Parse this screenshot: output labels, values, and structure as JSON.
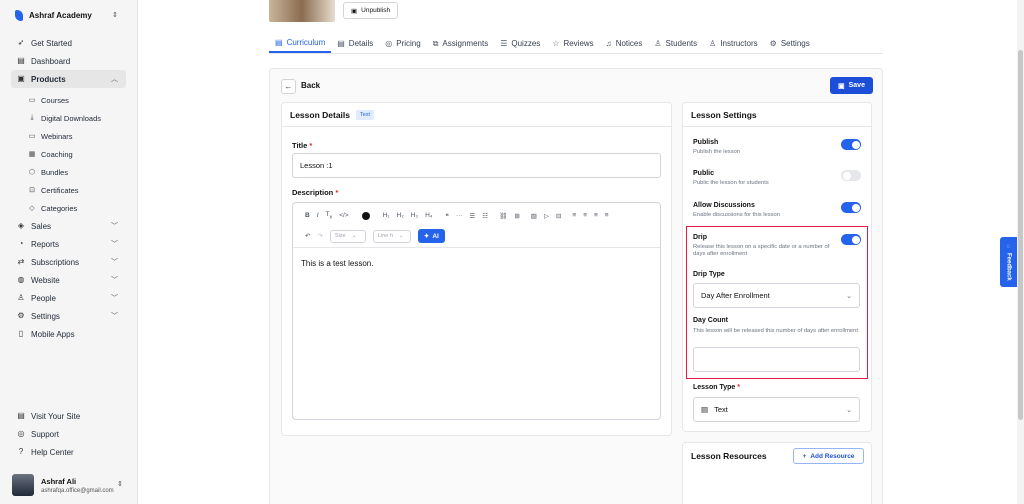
{
  "sidebar": {
    "brand": "Ashraf Academy",
    "items": [
      {
        "label": "Get Started",
        "icon": "rocket-icon"
      },
      {
        "label": "Dashboard",
        "icon": "dashboard-icon"
      },
      {
        "label": "Products",
        "icon": "box-icon"
      }
    ],
    "products_sub": [
      {
        "label": "Courses",
        "icon": "courses-icon"
      },
      {
        "label": "Digital Downloads",
        "icon": "download-icon"
      },
      {
        "label": "Webinars",
        "icon": "video-icon"
      },
      {
        "label": "Coaching",
        "icon": "calendar-icon"
      },
      {
        "label": "Bundles",
        "icon": "bundle-icon"
      },
      {
        "label": "Certificates",
        "icon": "certificate-icon"
      },
      {
        "label": "Categories",
        "icon": "categories-icon"
      }
    ],
    "items2": [
      {
        "label": "Sales",
        "icon": "tag-icon"
      },
      {
        "label": "Reports",
        "icon": "reports-icon"
      },
      {
        "label": "Subscriptions",
        "icon": "subscriptions-icon"
      },
      {
        "label": "Website",
        "icon": "globe-icon"
      },
      {
        "label": "People",
        "icon": "person-icon"
      },
      {
        "label": "Settings",
        "icon": "gear-icon"
      },
      {
        "label": "Mobile Apps",
        "icon": "mobile-icon"
      }
    ],
    "bottom": [
      {
        "label": "Visit Your Site",
        "icon": "external-icon"
      },
      {
        "label": "Support",
        "icon": "support-icon"
      },
      {
        "label": "Help Center",
        "icon": "help-icon"
      }
    ],
    "user": {
      "name": "Ashraf Ali",
      "email": "ashrafqa.office@gmail.com"
    }
  },
  "header": {
    "unpublish_label": "Unpublish",
    "tabs": [
      "Curriculum",
      "Details",
      "Pricing",
      "Assignments",
      "Quizzes",
      "Reviews",
      "Notices",
      "Students",
      "Instructors",
      "Settings"
    ]
  },
  "back_label": "Back",
  "save_label": "Save",
  "details": {
    "heading": "Lesson Details",
    "badge": "Text",
    "title_label": "Title",
    "title_value": "Lesson :1",
    "description_label": "Description",
    "toolbar": {
      "row1": [
        "B",
        "I",
        "Tx",
        "</>",
        "H1",
        "H2",
        "H3",
        "H4",
        "99",
        "···",
        "≡",
        "≡",
        "🔗",
        "▦",
        "▣",
        "▶",
        "⊞",
        "≡",
        "≡",
        "≡",
        "≡"
      ],
      "size_placeholder": "Size",
      "lineheight_placeholder": "Line h",
      "ai_label": "AI"
    },
    "body": "This is a test lesson."
  },
  "settings": {
    "heading": "Lesson Settings",
    "publish": {
      "title": "Publish",
      "desc": "Publish the lesson",
      "on": true
    },
    "public": {
      "title": "Public",
      "desc": "Public the lesson for students",
      "on": false
    },
    "discussions": {
      "title": "Allow Discussions",
      "desc": "Enable discussions for this lesson",
      "on": true
    },
    "drip": {
      "title": "Drip",
      "desc": "Release this lesson on a specific date or a number of days after enrollment",
      "on": true
    },
    "drip_type_label": "Drip Type",
    "drip_type_value": "Day After Enrollment",
    "day_count_label": "Day Count",
    "day_count_desc": "This lesson will be released this number of days after enrollment",
    "day_count_value": "",
    "lesson_type_label": "Lesson Type",
    "lesson_type_value": "Text"
  },
  "resources": {
    "heading": "Lesson Resources",
    "add_label": "Add Resource"
  },
  "feedback_label": "Feedback",
  "colors": {
    "accent": "#2563eb",
    "highlight": "#e11d48"
  }
}
